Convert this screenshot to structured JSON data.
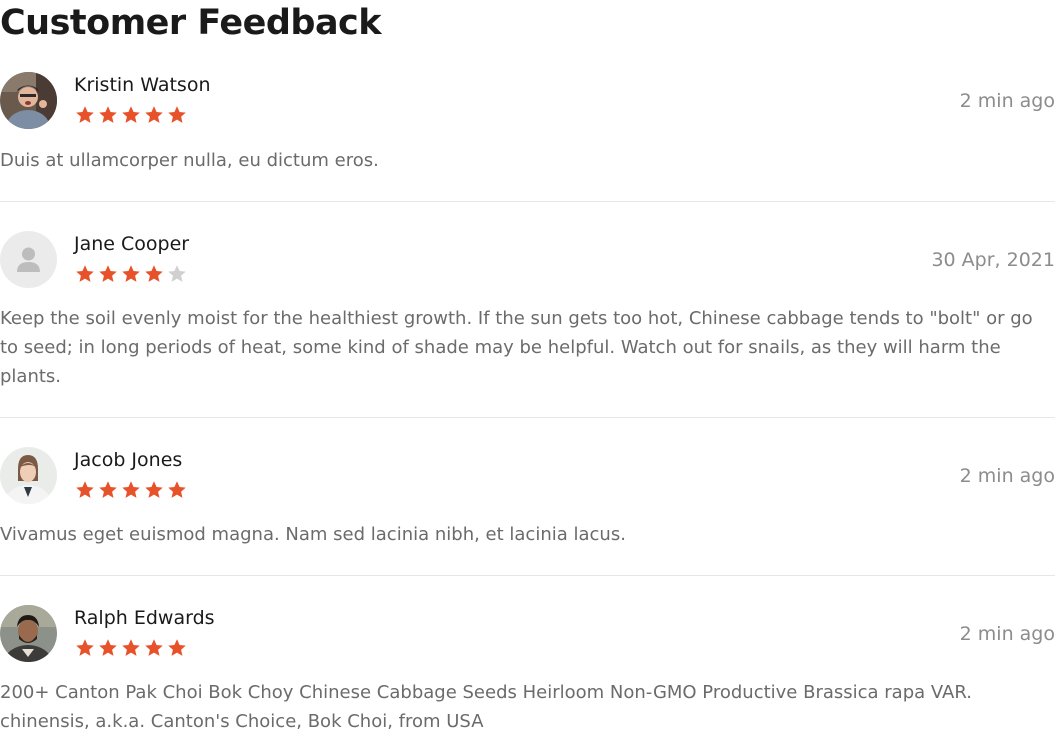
{
  "page": {
    "title": "Customer Feedback"
  },
  "colors": {
    "star_filled": "#e8522a",
    "star_empty": "#d0d0d0",
    "muted_text": "#8c8c8c"
  },
  "reviews": [
    {
      "name": "Kristin Watson",
      "rating": 5,
      "date": "2 min ago",
      "text": "Duis at ullamcorper nulla, eu dictum eros.",
      "avatar": "photo"
    },
    {
      "name": "Jane Cooper",
      "rating": 4,
      "date": "30 Apr, 2021",
      "text": "Keep the soil evenly moist for the healthiest growth. If the sun gets too hot, Chinese cabbage tends to \"bolt\" or go to seed; in long periods of heat, some kind of shade may be helpful. Watch out for snails, as they will harm the plants.",
      "avatar": "placeholder-user-icon"
    },
    {
      "name": "Jacob Jones",
      "rating": 5,
      "date": "2 min ago",
      "text": " Vivamus eget euismod magna. Nam sed lacinia nibh, et lacinia lacus.",
      "avatar": "photo"
    },
    {
      "name": "Ralph Edwards",
      "rating": 5,
      "date": "2 min ago",
      "text": "200+ Canton Pak Choi Bok Choy Chinese Cabbage Seeds Heirloom Non-GMO Productive Brassica rapa VAR. chinensis, a.k.a. Canton's Choice, Bok Choi, from USA",
      "avatar": "photo"
    }
  ]
}
